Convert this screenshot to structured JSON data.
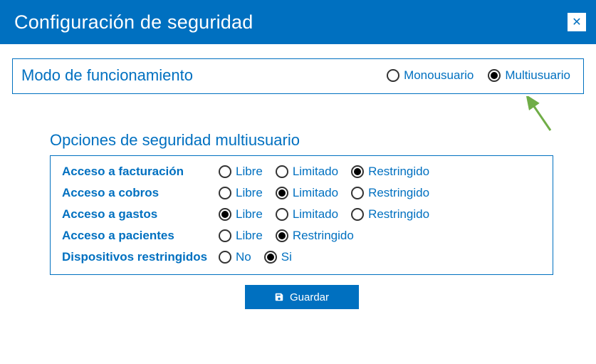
{
  "colors": {
    "accent": "#0070c0",
    "arrow": "#70ad47"
  },
  "title": "Configuración de seguridad",
  "mode": {
    "label": "Modo de funcionamiento",
    "options": {
      "mono": "Monousuario",
      "multi": "Multiusuario"
    },
    "selected": "multi"
  },
  "multi_options": {
    "title": "Opciones de seguridad multiusuario",
    "rows": {
      "facturacion": {
        "label": "Acceso a facturación",
        "libre": "Libre",
        "limitado": "Limitado",
        "restringido": "Restringido",
        "selected": "restringido"
      },
      "cobros": {
        "label": "Acceso a cobros",
        "libre": "Libre",
        "limitado": "Limitado",
        "restringido": "Restringido",
        "selected": "limitado"
      },
      "gastos": {
        "label": "Acceso a gastos",
        "libre": "Libre",
        "limitado": "Limitado",
        "restringido": "Restringido",
        "selected": "libre"
      },
      "pacientes": {
        "label": "Acceso a pacientes",
        "libre": "Libre",
        "restringido": "Restringido",
        "selected": "restringido"
      },
      "dispositivos": {
        "label": "Dispositivos restringidos",
        "no": "No",
        "si": "Si",
        "selected": "si"
      }
    }
  },
  "save_label": "Guardar"
}
